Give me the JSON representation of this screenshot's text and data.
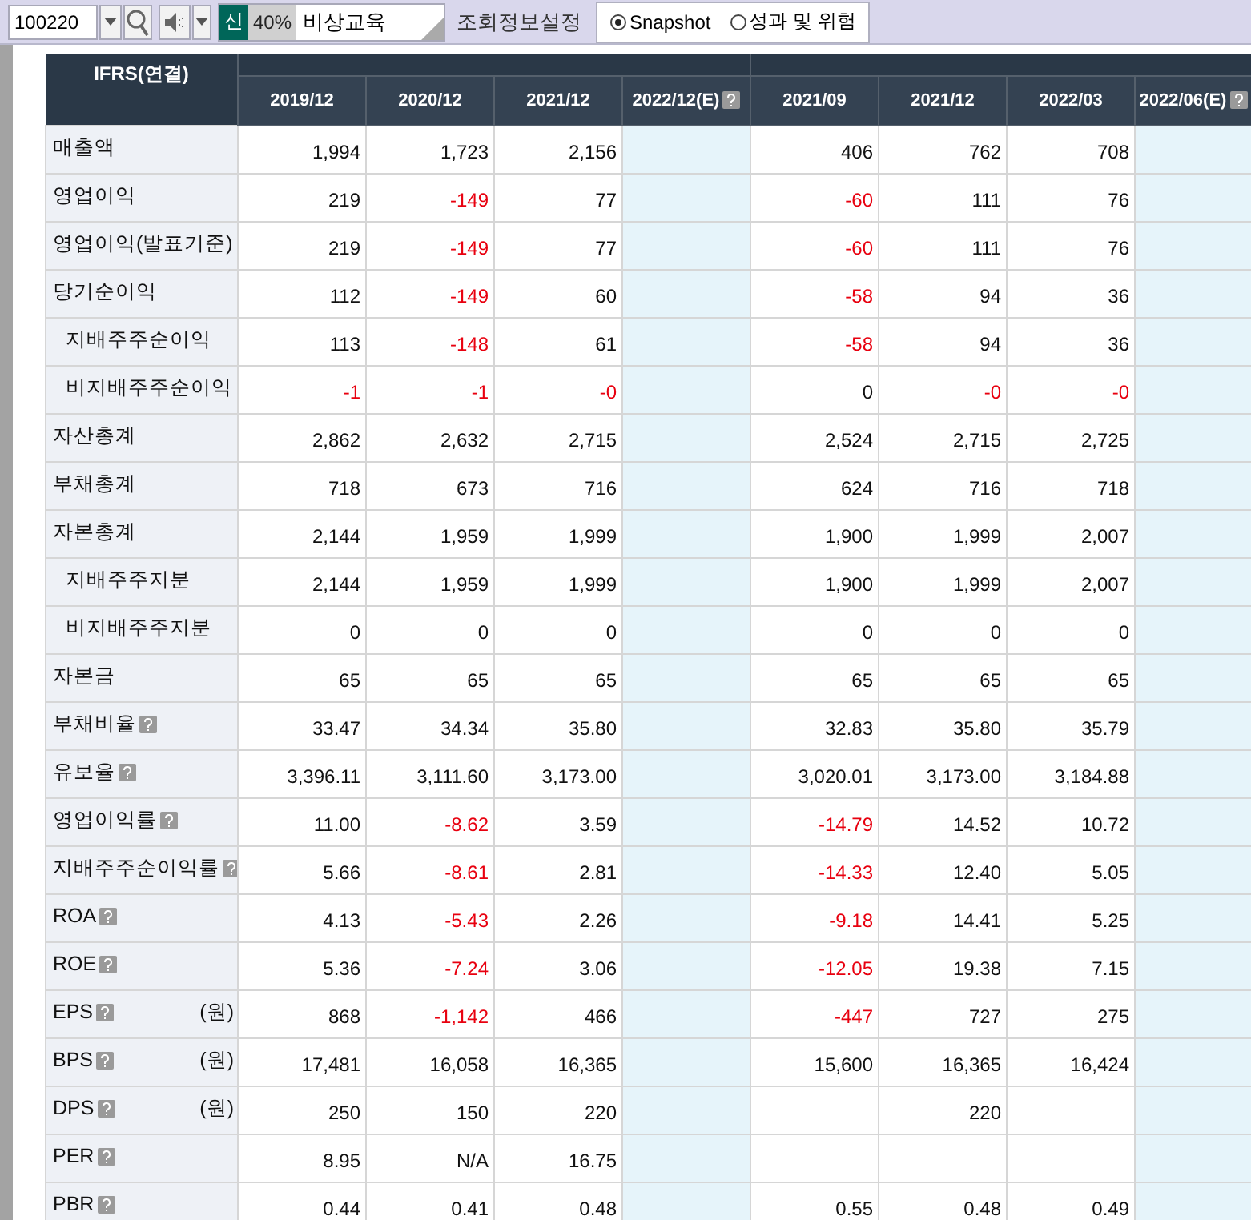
{
  "toolbar": {
    "code": "100220",
    "badges": [
      {
        "kind": "new",
        "text": "신"
      },
      {
        "kind": "ratio",
        "text": "40%"
      }
    ],
    "company": "비상교육",
    "settings_label": "조회정보설정",
    "views": [
      {
        "label": "Snapshot",
        "selected": true
      },
      {
        "label": "성과 및 위험",
        "selected": false
      }
    ]
  },
  "table": {
    "corner": "IFRS(연결)",
    "columns": [
      {
        "label": "2019/12",
        "estimate": false
      },
      {
        "label": "2020/12",
        "estimate": false
      },
      {
        "label": "2021/12",
        "estimate": false
      },
      {
        "label": "2022/12(E)",
        "estimate": true
      },
      {
        "label": "2021/09",
        "estimate": false
      },
      {
        "label": "2021/12",
        "estimate": false
      },
      {
        "label": "2022/03",
        "estimate": false
      },
      {
        "label": "2022/06(E)",
        "estimate": true
      }
    ],
    "rows": [
      {
        "label": "매출액",
        "cells": [
          {
            "kind": "value",
            "text": "1,994",
            "negative": false
          },
          {
            "kind": "value",
            "text": "1,723",
            "negative": false
          },
          {
            "kind": "value",
            "text": "2,156",
            "negative": false
          },
          {
            "kind": "blank"
          },
          {
            "kind": "value",
            "text": "406",
            "negative": false
          },
          {
            "kind": "value",
            "text": "762",
            "negative": false
          },
          {
            "kind": "value",
            "text": "708",
            "negative": false
          },
          {
            "kind": "blank"
          }
        ]
      },
      {
        "label": "영업이익",
        "cells": [
          {
            "kind": "value",
            "text": "219",
            "negative": false
          },
          {
            "kind": "value",
            "text": "-149",
            "negative": true
          },
          {
            "kind": "value",
            "text": "77",
            "negative": false
          },
          {
            "kind": "blank"
          },
          {
            "kind": "value",
            "text": "-60",
            "negative": true
          },
          {
            "kind": "value",
            "text": "111",
            "negative": false
          },
          {
            "kind": "value",
            "text": "76",
            "negative": false
          },
          {
            "kind": "blank"
          }
        ]
      },
      {
        "label": "영업이익(발표기준)",
        "cells": [
          {
            "kind": "value",
            "text": "219",
            "negative": false
          },
          {
            "kind": "value",
            "text": "-149",
            "negative": true
          },
          {
            "kind": "value",
            "text": "77",
            "negative": false
          },
          {
            "kind": "blank"
          },
          {
            "kind": "value",
            "text": "-60",
            "negative": true
          },
          {
            "kind": "value",
            "text": "111",
            "negative": false
          },
          {
            "kind": "value",
            "text": "76",
            "negative": false
          },
          {
            "kind": "blank"
          }
        ]
      },
      {
        "label": "당기순이익",
        "cells": [
          {
            "kind": "value",
            "text": "112",
            "negative": false
          },
          {
            "kind": "value",
            "text": "-149",
            "negative": true
          },
          {
            "kind": "value",
            "text": "60",
            "negative": false
          },
          {
            "kind": "blank"
          },
          {
            "kind": "value",
            "text": "-58",
            "negative": true
          },
          {
            "kind": "value",
            "text": "94",
            "negative": false
          },
          {
            "kind": "value",
            "text": "36",
            "negative": false
          },
          {
            "kind": "blank"
          }
        ],
        "children": [
          {
            "label": "지배주주순이익",
            "cells": [
              {
                "kind": "value",
                "text": "113",
                "negative": false
              },
              {
                "kind": "value",
                "text": "-148",
                "negative": true
              },
              {
                "kind": "value",
                "text": "61",
                "negative": false
              },
              {
                "kind": "blank"
              },
              {
                "kind": "value",
                "text": "-58",
                "negative": true
              },
              {
                "kind": "value",
                "text": "94",
                "negative": false
              },
              {
                "kind": "value",
                "text": "36",
                "negative": false
              },
              {
                "kind": "blank"
              }
            ]
          },
          {
            "label": "비지배주주순이익",
            "cells": [
              {
                "kind": "value",
                "text": "-1",
                "negative": true
              },
              {
                "kind": "value",
                "text": "-1",
                "negative": true
              },
              {
                "kind": "value",
                "text": "-0",
                "negative": true
              },
              {
                "kind": "blank"
              },
              {
                "kind": "value",
                "text": "0",
                "negative": false
              },
              {
                "kind": "value",
                "text": "-0",
                "negative": true
              },
              {
                "kind": "value",
                "text": "-0",
                "negative": true
              },
              {
                "kind": "blank"
              }
            ]
          }
        ]
      },
      {
        "label": "자산총계",
        "cells": [
          {
            "kind": "value",
            "text": "2,862",
            "negative": false
          },
          {
            "kind": "value",
            "text": "2,632",
            "negative": false
          },
          {
            "kind": "value",
            "text": "2,715",
            "negative": false
          },
          {
            "kind": "blank"
          },
          {
            "kind": "value",
            "text": "2,524",
            "negative": false
          },
          {
            "kind": "value",
            "text": "2,715",
            "negative": false
          },
          {
            "kind": "value",
            "text": "2,725",
            "negative": false
          },
          {
            "kind": "blank"
          }
        ]
      },
      {
        "label": "부채총계",
        "cells": [
          {
            "kind": "value",
            "text": "718",
            "negative": false
          },
          {
            "kind": "value",
            "text": "673",
            "negative": false
          },
          {
            "kind": "value",
            "text": "716",
            "negative": false
          },
          {
            "kind": "blank"
          },
          {
            "kind": "value",
            "text": "624",
            "negative": false
          },
          {
            "kind": "value",
            "text": "716",
            "negative": false
          },
          {
            "kind": "value",
            "text": "718",
            "negative": false
          },
          {
            "kind": "blank"
          }
        ]
      },
      {
        "label": "자본총계",
        "cells": [
          {
            "kind": "value",
            "text": "2,144",
            "negative": false
          },
          {
            "kind": "value",
            "text": "1,959",
            "negative": false
          },
          {
            "kind": "value",
            "text": "1,999",
            "negative": false
          },
          {
            "kind": "blank"
          },
          {
            "kind": "value",
            "text": "1,900",
            "negative": false
          },
          {
            "kind": "value",
            "text": "1,999",
            "negative": false
          },
          {
            "kind": "value",
            "text": "2,007",
            "negative": false
          },
          {
            "kind": "blank"
          }
        ],
        "children": [
          {
            "label": "지배주주지분",
            "cells": [
              {
                "kind": "value",
                "text": "2,144",
                "negative": false
              },
              {
                "kind": "value",
                "text": "1,959",
                "negative": false
              },
              {
                "kind": "value",
                "text": "1,999",
                "negative": false
              },
              {
                "kind": "blank"
              },
              {
                "kind": "value",
                "text": "1,900",
                "negative": false
              },
              {
                "kind": "value",
                "text": "1,999",
                "negative": false
              },
              {
                "kind": "value",
                "text": "2,007",
                "negative": false
              },
              {
                "kind": "blank"
              }
            ]
          },
          {
            "label": "비지배주주지분",
            "cells": [
              {
                "kind": "value",
                "text": "0",
                "negative": false
              },
              {
                "kind": "value",
                "text": "0",
                "negative": false
              },
              {
                "kind": "value",
                "text": "0",
                "negative": false
              },
              {
                "kind": "blank"
              },
              {
                "kind": "value",
                "text": "0",
                "negative": false
              },
              {
                "kind": "value",
                "text": "0",
                "negative": false
              },
              {
                "kind": "value",
                "text": "0",
                "negative": false
              },
              {
                "kind": "blank"
              }
            ]
          }
        ]
      },
      {
        "label": "자본금",
        "cells": [
          {
            "kind": "value",
            "text": "65",
            "negative": false
          },
          {
            "kind": "value",
            "text": "65",
            "negative": false
          },
          {
            "kind": "value",
            "text": "65",
            "negative": false
          },
          {
            "kind": "blank"
          },
          {
            "kind": "value",
            "text": "65",
            "negative": false
          },
          {
            "kind": "value",
            "text": "65",
            "negative": false
          },
          {
            "kind": "value",
            "text": "65",
            "negative": false
          },
          {
            "kind": "blank"
          }
        ]
      },
      {
        "label": "부채비율",
        "help": true,
        "cells": [
          {
            "kind": "value",
            "text": "33.47",
            "negative": false
          },
          {
            "kind": "value",
            "text": "34.34",
            "negative": false
          },
          {
            "kind": "value",
            "text": "35.80",
            "negative": false
          },
          {
            "kind": "blank"
          },
          {
            "kind": "value",
            "text": "32.83",
            "negative": false
          },
          {
            "kind": "value",
            "text": "35.80",
            "negative": false
          },
          {
            "kind": "value",
            "text": "35.79",
            "negative": false
          },
          {
            "kind": "blank"
          }
        ]
      },
      {
        "label": "유보율",
        "help": true,
        "cells": [
          {
            "kind": "value",
            "text": "3,396.11",
            "negative": false
          },
          {
            "kind": "value",
            "text": "3,111.60",
            "negative": false
          },
          {
            "kind": "value",
            "text": "3,173.00",
            "negative": false
          },
          {
            "kind": "blank"
          },
          {
            "kind": "value",
            "text": "3,020.01",
            "negative": false
          },
          {
            "kind": "value",
            "text": "3,173.00",
            "negative": false
          },
          {
            "kind": "value",
            "text": "3,184.88",
            "negative": false
          },
          {
            "kind": "blank"
          }
        ]
      },
      {
        "label": "영업이익률",
        "help": true,
        "cells": [
          {
            "kind": "value",
            "text": "11.00",
            "negative": false
          },
          {
            "kind": "value",
            "text": "-8.62",
            "negative": true
          },
          {
            "kind": "value",
            "text": "3.59",
            "negative": false
          },
          {
            "kind": "blank"
          },
          {
            "kind": "value",
            "text": "-14.79",
            "negative": true
          },
          {
            "kind": "value",
            "text": "14.52",
            "negative": false
          },
          {
            "kind": "value",
            "text": "10.72",
            "negative": false
          },
          {
            "kind": "blank"
          }
        ]
      },
      {
        "label": "지배주주순이익률",
        "help": true,
        "cells": [
          {
            "kind": "value",
            "text": "5.66",
            "negative": false
          },
          {
            "kind": "value",
            "text": "-8.61",
            "negative": true
          },
          {
            "kind": "value",
            "text": "2.81",
            "negative": false
          },
          {
            "kind": "blank"
          },
          {
            "kind": "value",
            "text": "-14.33",
            "negative": true
          },
          {
            "kind": "value",
            "text": "12.40",
            "negative": false
          },
          {
            "kind": "value",
            "text": "5.05",
            "negative": false
          },
          {
            "kind": "blank"
          }
        ]
      },
      {
        "label": "ROA",
        "help": true,
        "cells": [
          {
            "kind": "value",
            "text": "4.13",
            "negative": false
          },
          {
            "kind": "value",
            "text": "-5.43",
            "negative": true
          },
          {
            "kind": "value",
            "text": "2.26",
            "negative": false
          },
          {
            "kind": "blank"
          },
          {
            "kind": "value",
            "text": "-9.18",
            "negative": true
          },
          {
            "kind": "value",
            "text": "14.41",
            "negative": false
          },
          {
            "kind": "value",
            "text": "5.25",
            "negative": false
          },
          {
            "kind": "blank"
          }
        ]
      },
      {
        "label": "ROE",
        "help": true,
        "cells": [
          {
            "kind": "value",
            "text": "5.36",
            "negative": false
          },
          {
            "kind": "value",
            "text": "-7.24",
            "negative": true
          },
          {
            "kind": "value",
            "text": "3.06",
            "negative": false
          },
          {
            "kind": "blank"
          },
          {
            "kind": "value",
            "text": "-12.05",
            "negative": true
          },
          {
            "kind": "value",
            "text": "19.38",
            "negative": false
          },
          {
            "kind": "value",
            "text": "7.15",
            "negative": false
          },
          {
            "kind": "blank"
          }
        ]
      },
      {
        "label": "EPS",
        "help": true,
        "unit": "(원)",
        "cells": [
          {
            "kind": "value",
            "text": "868",
            "negative": false
          },
          {
            "kind": "value",
            "text": "-1,142",
            "negative": true
          },
          {
            "kind": "value",
            "text": "466",
            "negative": false
          },
          {
            "kind": "blank"
          },
          {
            "kind": "value",
            "text": "-447",
            "negative": true
          },
          {
            "kind": "value",
            "text": "727",
            "negative": false
          },
          {
            "kind": "value",
            "text": "275",
            "negative": false
          },
          {
            "kind": "blank"
          }
        ]
      },
      {
        "label": "BPS",
        "help": true,
        "unit": "(원)",
        "cells": [
          {
            "kind": "value",
            "text": "17,481",
            "negative": false
          },
          {
            "kind": "value",
            "text": "16,058",
            "negative": false
          },
          {
            "kind": "value",
            "text": "16,365",
            "negative": false
          },
          {
            "kind": "blank"
          },
          {
            "kind": "value",
            "text": "15,600",
            "negative": false
          },
          {
            "kind": "value",
            "text": "16,365",
            "negative": false
          },
          {
            "kind": "value",
            "text": "16,424",
            "negative": false
          },
          {
            "kind": "blank"
          }
        ]
      },
      {
        "label": "DPS",
        "help": true,
        "unit": "(원)",
        "cells": [
          {
            "kind": "value",
            "text": "250",
            "negative": false
          },
          {
            "kind": "value",
            "text": "150",
            "negative": false
          },
          {
            "kind": "value",
            "text": "220",
            "negative": false
          },
          {
            "kind": "blank"
          },
          {
            "kind": "blank"
          },
          {
            "kind": "value",
            "text": "220",
            "negative": false
          },
          {
            "kind": "blank"
          },
          {
            "kind": "blank"
          }
        ]
      },
      {
        "label": "PER",
        "help": true,
        "cells": [
          {
            "kind": "value",
            "text": "8.95",
            "negative": false
          },
          {
            "kind": "value",
            "text": "N/A",
            "negative": false
          },
          {
            "kind": "value",
            "text": "16.75",
            "negative": false
          },
          {
            "kind": "blank"
          },
          {
            "kind": "blank"
          },
          {
            "kind": "blank"
          },
          {
            "kind": "blank"
          },
          {
            "kind": "blank"
          }
        ]
      },
      {
        "label": "PBR",
        "help": true,
        "cells": [
          {
            "kind": "value",
            "text": "0.44",
            "negative": false
          },
          {
            "kind": "value",
            "text": "0.41",
            "negative": false
          },
          {
            "kind": "value",
            "text": "0.48",
            "negative": false
          },
          {
            "kind": "blank"
          },
          {
            "kind": "value",
            "text": "0.55",
            "negative": false
          },
          {
            "kind": "value",
            "text": "0.48",
            "negative": false
          },
          {
            "kind": "value",
            "text": "0.49",
            "negative": false
          },
          {
            "kind": "blank"
          }
        ]
      }
    ]
  }
}
